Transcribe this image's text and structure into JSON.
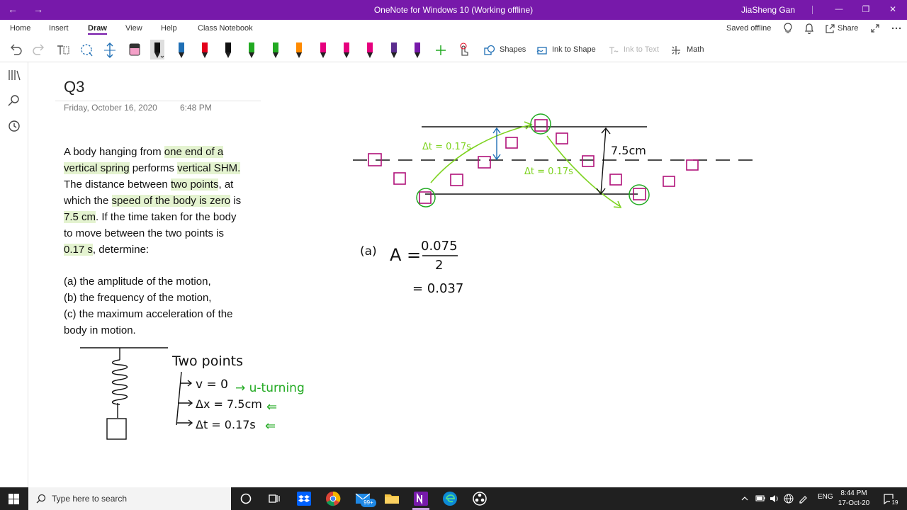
{
  "titlebar": {
    "title": "OneNote for Windows 10 (Working offline)",
    "user": "JiaSheng Gan",
    "back_glyph": "←",
    "fwd_glyph": "→",
    "min_glyph": "—",
    "max_glyph": "❐",
    "close_glyph": "✕"
  },
  "ribbon": {
    "tabs": [
      "Home",
      "Insert",
      "Draw",
      "View",
      "Help",
      "Class Notebook"
    ],
    "active_tab": "Draw",
    "status": "Saved offline",
    "share": "Share"
  },
  "toolbar": {
    "shapes": "Shapes",
    "ink_to_shape": "Ink to Shape",
    "ink_to_text": "Ink to Text",
    "math": "Math",
    "pen_colors": [
      "#111111",
      "#111111",
      "#1f6fb5",
      "#e3001b",
      "#111111",
      "#22aa22",
      "#22aa22",
      "#ff8a00",
      "#e6007e",
      "#e6007e",
      "#e6007e",
      "#5b2d8e",
      "#7719aa",
      "#666666"
    ]
  },
  "page": {
    "title": "Q3",
    "date": "Friday, October 16, 2020",
    "time": "6:48 PM",
    "question_lines": [
      [
        "A body hanging from ",
        "one end of a"
      ],
      [
        "vertical spring",
        " performs ",
        "vertical SHM."
      ],
      [
        "The distance between ",
        "two points",
        ", at"
      ],
      [
        "which the ",
        "speed of the body is zero",
        " is"
      ],
      [
        "7.5 cm",
        ".  If the time taken for the body"
      ],
      [
        "to move between the two points is"
      ],
      [
        "0.17 s",
        ", determine:"
      ]
    ],
    "parts": [
      "(a) the amplitude of the motion,",
      "(b) the frequency of the motion,",
      "(c) the maximum acceleration of the",
      "body in motion."
    ]
  },
  "ink": {
    "two_points": "Two points",
    "v0": "v = 0",
    "u_turning": "→ u-turning",
    "dx": "Δx = 7.5cm",
    "dt": "Δt = 0.17s",
    "arrow_back": "⇐",
    "dt_label": "Δt = 0.17s",
    "amp_label": "7.5cm",
    "part_a": "(a)",
    "A_eq": "A =",
    "num": "0.075",
    "den": "2",
    "result": "= 0.037"
  },
  "taskbar": {
    "search_placeholder": "Type here to search",
    "badge": "99+",
    "lang": "ENG",
    "time": "8:44 PM",
    "date": "17-Oct-20",
    "notif_count": "19"
  }
}
